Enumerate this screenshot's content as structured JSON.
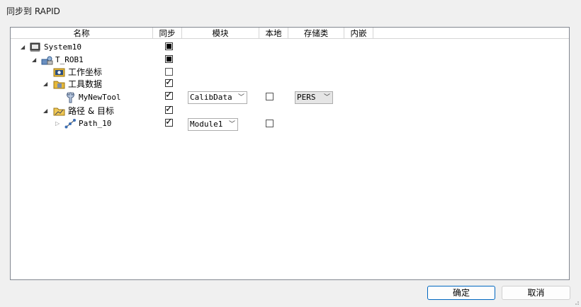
{
  "window": {
    "title": "同步到 RAPID"
  },
  "columns": [
    "名称",
    "同步",
    "模块",
    "本地",
    "存储类",
    "内嵌"
  ],
  "tree": [
    {
      "label": "System10",
      "icon": "controller-icon",
      "arrow": "expanded",
      "sync": "partial"
    },
    {
      "label": "T_ROB1",
      "icon": "robot-task-icon",
      "arrow": "expanded",
      "sync": "partial"
    },
    {
      "label": "工作坐标",
      "icon": "workobject-folder-icon",
      "arrow": "none",
      "sync": "unchecked"
    },
    {
      "label": "工具数据",
      "icon": "tooldata-folder-icon",
      "arrow": "expanded",
      "sync": "checked"
    },
    {
      "label": "MyNewTool",
      "icon": "tool-icon",
      "arrow": "none",
      "sync": "checked",
      "module": "CalibData",
      "local": "unchecked",
      "storage": "PERS"
    },
    {
      "label": "路径 & 目标",
      "icon": "paths-folder-icon",
      "arrow": "expanded",
      "sync": "checked"
    },
    {
      "label": "Path_10",
      "icon": "path-icon",
      "arrow": "collapsed",
      "sync": "checked",
      "module": "Module1",
      "local": "unchecked"
    }
  ],
  "buttons": {
    "ok": "确定",
    "cancel": "取消"
  }
}
